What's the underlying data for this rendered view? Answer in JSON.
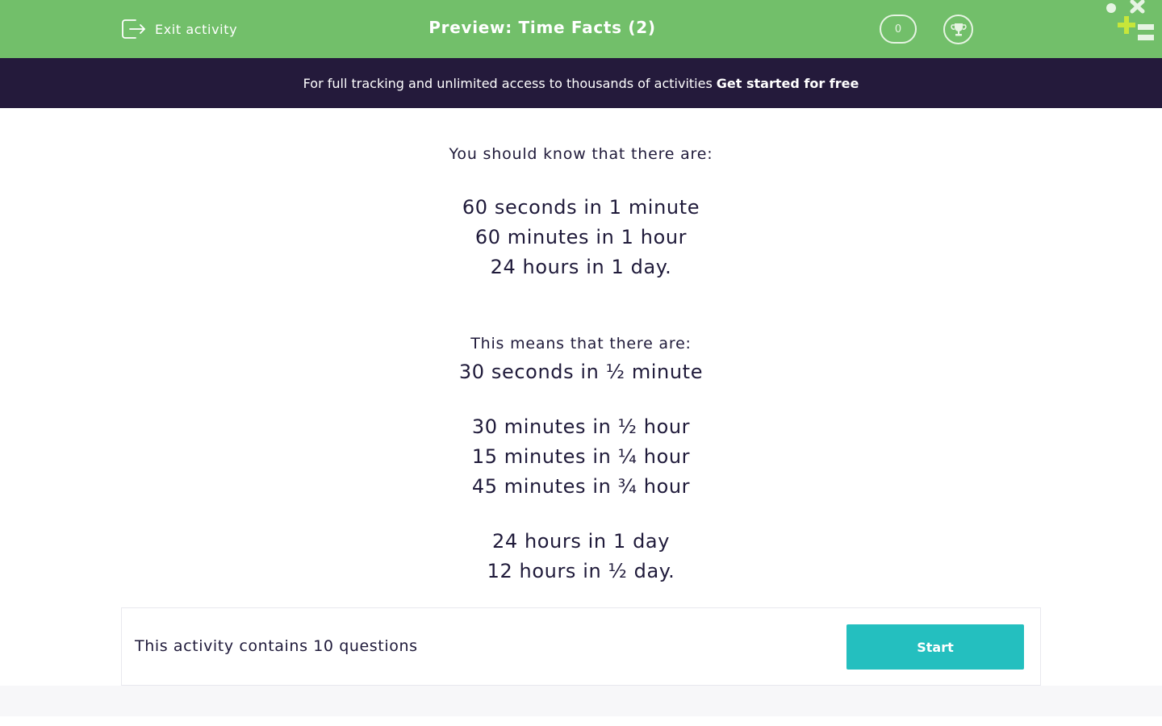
{
  "header": {
    "exit_label": "Exit activity",
    "title": "Preview: Time Facts (2)",
    "score": "0"
  },
  "banner": {
    "text": "For full tracking and unlimited access to thousands of activities",
    "link": "Get started for free"
  },
  "content": {
    "intro1": "You should know that there are:",
    "facts1": [
      "60 seconds in 1 minute",
      "60 minutes in 1 hour",
      "24 hours in 1 day."
    ],
    "intro2": "This means that there are:",
    "facts2": [
      "30 seconds in ½ minute"
    ],
    "facts3": [
      "30 minutes in ½ hour",
      "15 minutes in ¼ hour",
      "45 minutes in ¾ hour"
    ],
    "facts4": [
      "24 hours in 1 day",
      "12 hours in ½ day."
    ]
  },
  "footer": {
    "question_count": "This activity contains 10 questions",
    "start_label": "Start"
  },
  "colors": {
    "brand": "#72bf6a",
    "banner": "#241a3b",
    "accent": "#24bfbf",
    "logo_lime": "#c7e63a"
  },
  "icons": {
    "exit": "exit-icon",
    "trophy": "trophy-icon",
    "logo": "logo-icon"
  }
}
